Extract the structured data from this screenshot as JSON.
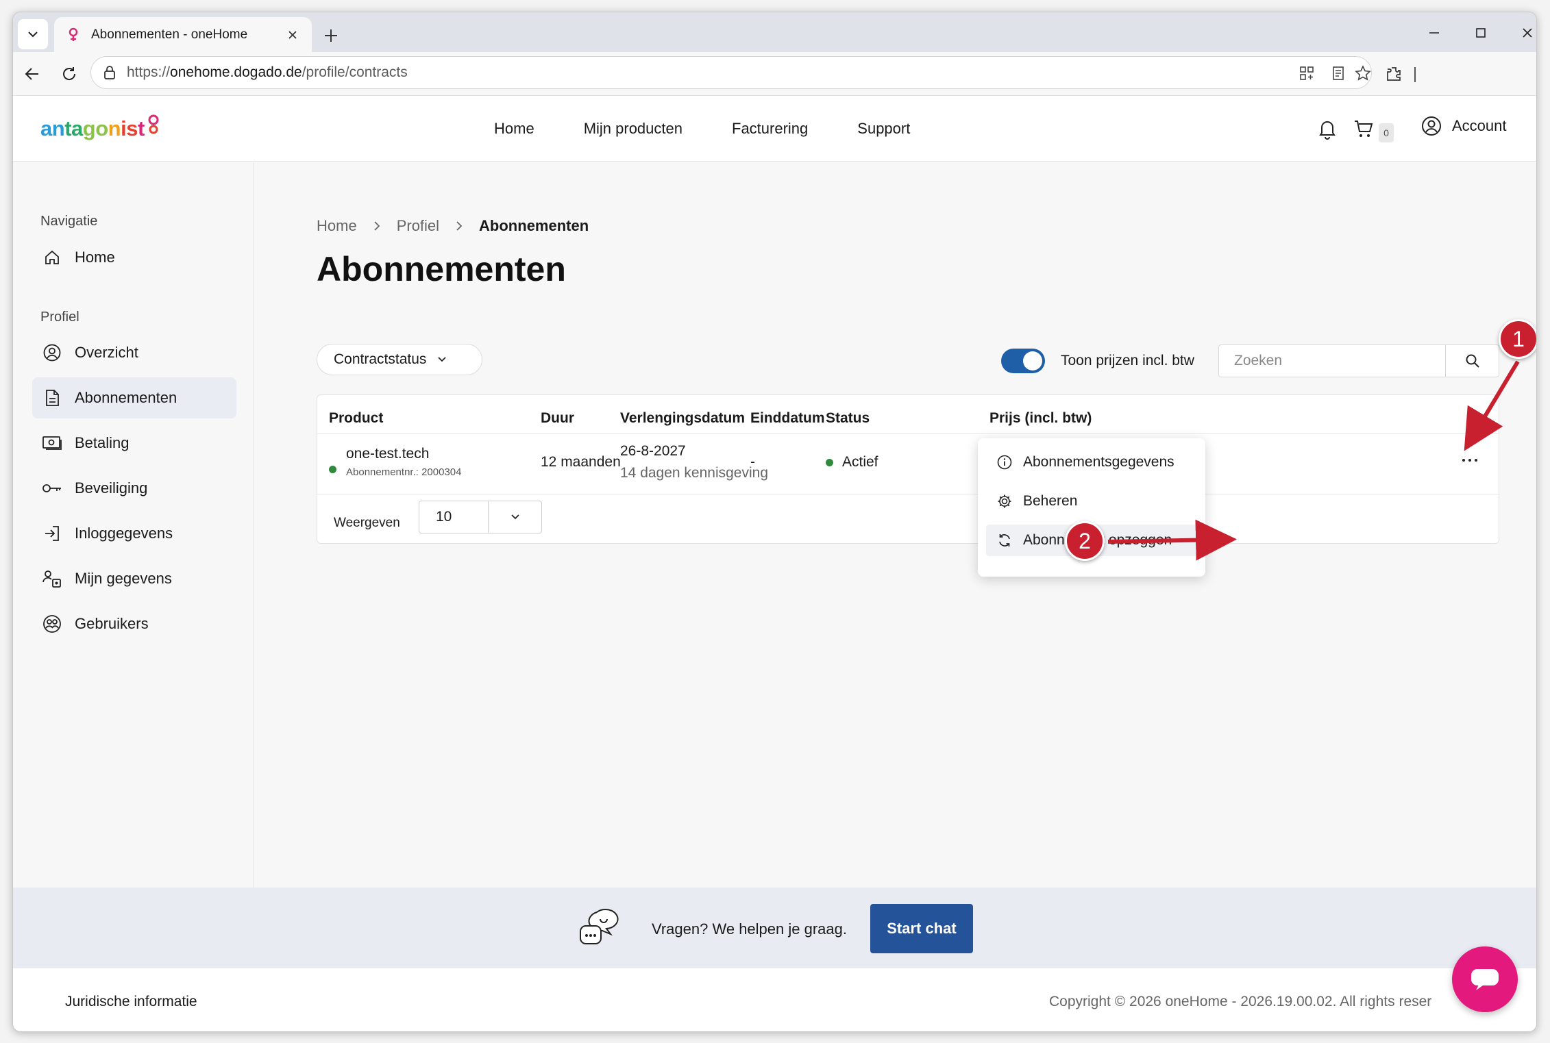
{
  "browser": {
    "tab_title": "Abonnementen - oneHome",
    "url_prefix": "https://",
    "url_host": "onehome.dogado.de",
    "url_path": "/profile/contracts"
  },
  "header": {
    "logo_text": "antagonist",
    "nav": [
      "Home",
      "Mijn producten",
      "Facturering",
      "Support"
    ],
    "cart_count": "0",
    "account_label": "Account"
  },
  "sidebar": {
    "heading_nav": "Navigatie",
    "heading_profile": "Profiel",
    "items": [
      {
        "label": "Home",
        "icon": "home-icon"
      },
      {
        "label": "Overzicht",
        "icon": "user-circle-icon"
      },
      {
        "label": "Abonnementen",
        "icon": "document-icon",
        "active": true
      },
      {
        "label": "Betaling",
        "icon": "payment-icon"
      },
      {
        "label": "Beveiliging",
        "icon": "key-icon"
      },
      {
        "label": "Inloggegevens",
        "icon": "login-icon"
      },
      {
        "label": "Mijn gegevens",
        "icon": "user-settings-icon"
      },
      {
        "label": "Gebruikers",
        "icon": "users-icon"
      }
    ]
  },
  "breadcrumb": [
    "Home",
    "Profiel",
    "Abonnementen"
  ],
  "page_title": "Abonnementen",
  "filters": {
    "status_label": "Contractstatus",
    "toggle_label": "Toon prijzen incl. btw",
    "toggle_on": true,
    "search_placeholder": "Zoeken"
  },
  "table": {
    "columns": [
      "Product",
      "Duur",
      "Verlengingsdatum",
      "Einddatum",
      "Status",
      "Prijs (incl. btw)"
    ],
    "rows": [
      {
        "product": "one-test.tech",
        "subscription_no": "Abonnementnr.: 2000304",
        "duration": "12 maanden",
        "renewal_date": "26-8-2027",
        "renewal_note": "14 dagen kennisgeving",
        "end_date": "-",
        "status": "Actief",
        "status_color": "#2f8a3b"
      }
    ],
    "show_label": "Weergeven",
    "page_size": "10"
  },
  "context_menu": {
    "items": [
      {
        "label": "Abonnementsgegevens",
        "icon": "info-icon"
      },
      {
        "label": "Beheren",
        "icon": "gear-icon"
      },
      {
        "label": "Abonnement opzeggen",
        "icon": "refresh-icon"
      }
    ]
  },
  "footer": {
    "chat_text": "Vragen? We helpen je graag.",
    "chat_button": "Start chat",
    "legal": "Juridische informatie",
    "copyright": "Copyright © 2026 oneHome - 2026.19.00.02. All rights reser"
  },
  "annotations": [
    "1",
    "2"
  ],
  "colors": {
    "accent_blue": "#24539a",
    "toggle_blue": "#1f5fa8",
    "fab_pink": "#e4197d",
    "annotation_red": "#c8202f"
  }
}
